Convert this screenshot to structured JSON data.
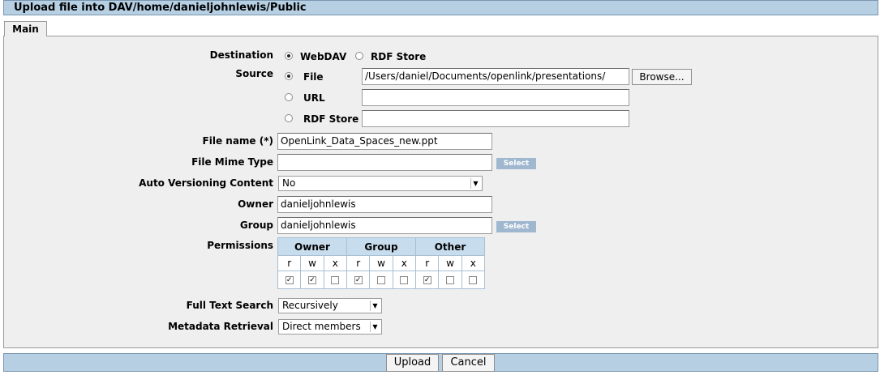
{
  "title": "Upload file into DAV/home/danieljohnlewis/Public",
  "tab": "Main",
  "destination": {
    "label": "Destination",
    "options": [
      "WebDAV",
      "RDF Store"
    ]
  },
  "source": {
    "label": "Source",
    "file_label": "File",
    "file_value": "/Users/daniel/Documents/openlink/presentations/",
    "browse": "Browse...",
    "url_label": "URL",
    "rdf_label": "RDF Store"
  },
  "file_name": {
    "label": "File name (*)",
    "value": "OpenLink_Data_Spaces_new.ppt"
  },
  "mime": {
    "label": "File Mime Type",
    "value": "",
    "select": "Select"
  },
  "versioning": {
    "label": "Auto Versioning Content",
    "value": "No"
  },
  "owner": {
    "label": "Owner",
    "value": "danieljohnlewis"
  },
  "group": {
    "label": "Group",
    "value": "danieljohnlewis",
    "select": "Select"
  },
  "permissions": {
    "label": "Permissions",
    "groups": [
      "Owner",
      "Group",
      "Other"
    ],
    "bits": [
      "r",
      "w",
      "x",
      "r",
      "w",
      "x",
      "r",
      "w",
      "x"
    ],
    "checked": [
      true,
      true,
      false,
      true,
      false,
      false,
      true,
      false,
      false
    ]
  },
  "fts": {
    "label": "Full Text Search",
    "value": "Recursively"
  },
  "metadata": {
    "label": "Metadata Retrieval",
    "value": "Direct members"
  },
  "buttons": {
    "upload": "Upload",
    "cancel": "Cancel"
  }
}
